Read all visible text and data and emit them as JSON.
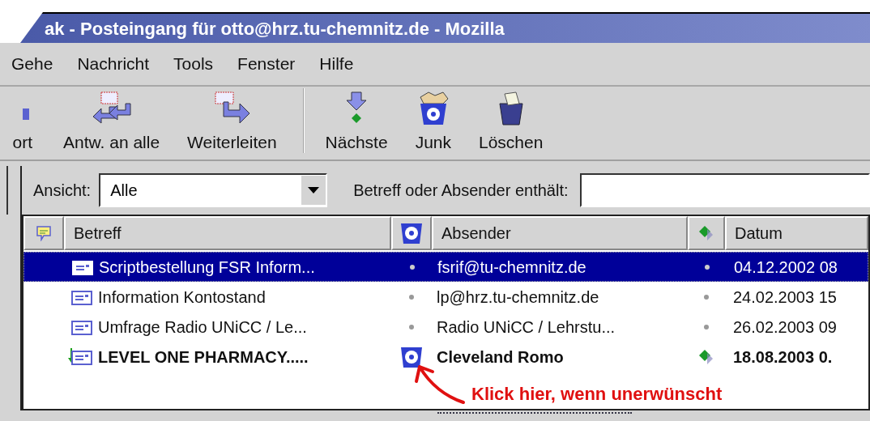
{
  "window": {
    "title": "ak - Posteingang für otto@hrz.tu-chemnitz.de - Mozilla"
  },
  "menu": [
    "Gehe",
    "Nachricht",
    "Tools",
    "Fenster",
    "Hilfe"
  ],
  "toolbar": [
    {
      "kind": "reply",
      "label": "ort"
    },
    {
      "kind": "replyall",
      "label": "Antw. an alle"
    },
    {
      "kind": "forward",
      "label": "Weiterleiten"
    },
    {
      "kind": "separator"
    },
    {
      "kind": "next",
      "label": "Nächste"
    },
    {
      "kind": "junk",
      "label": "Junk"
    },
    {
      "kind": "delete",
      "label": "Löschen"
    }
  ],
  "filter": {
    "view_label": "Ansicht:",
    "view_value": "Alle",
    "search_label": "Betreff oder Absender enthält:"
  },
  "table": {
    "columns": [
      {
        "kind": "thread"
      },
      {
        "kind": "text",
        "label": "Betreff"
      },
      {
        "kind": "junk"
      },
      {
        "kind": "text",
        "label": "Absender"
      },
      {
        "kind": "read"
      },
      {
        "kind": "text",
        "label": "Datum"
      }
    ],
    "rows": [
      {
        "subject": "Scriptbestellung FSR Inform...",
        "sender": "fsrif@tu-chemnitz.de",
        "date": "04.12.2002 08",
        "selected": true,
        "junk": false,
        "unread": false
      },
      {
        "subject": "Information Kontostand",
        "sender": "lp@hrz.tu-chemnitz.de",
        "date": "24.02.2003 15",
        "selected": false,
        "junk": false,
        "unread": false
      },
      {
        "subject": "Umfrage Radio UNiCC / Le...",
        "sender": "Radio UNiCC / Lehrstu...",
        "date": "26.02.2003 09",
        "selected": false,
        "junk": false,
        "unread": false
      },
      {
        "subject": "LEVEL ONE PHARMACY.....",
        "sender": "Cleveland Romo",
        "date": "18.08.2003 0.",
        "selected": false,
        "junk": true,
        "unread": true
      }
    ]
  },
  "annotation": {
    "text": "Klick hier, wenn unerwünscht"
  }
}
